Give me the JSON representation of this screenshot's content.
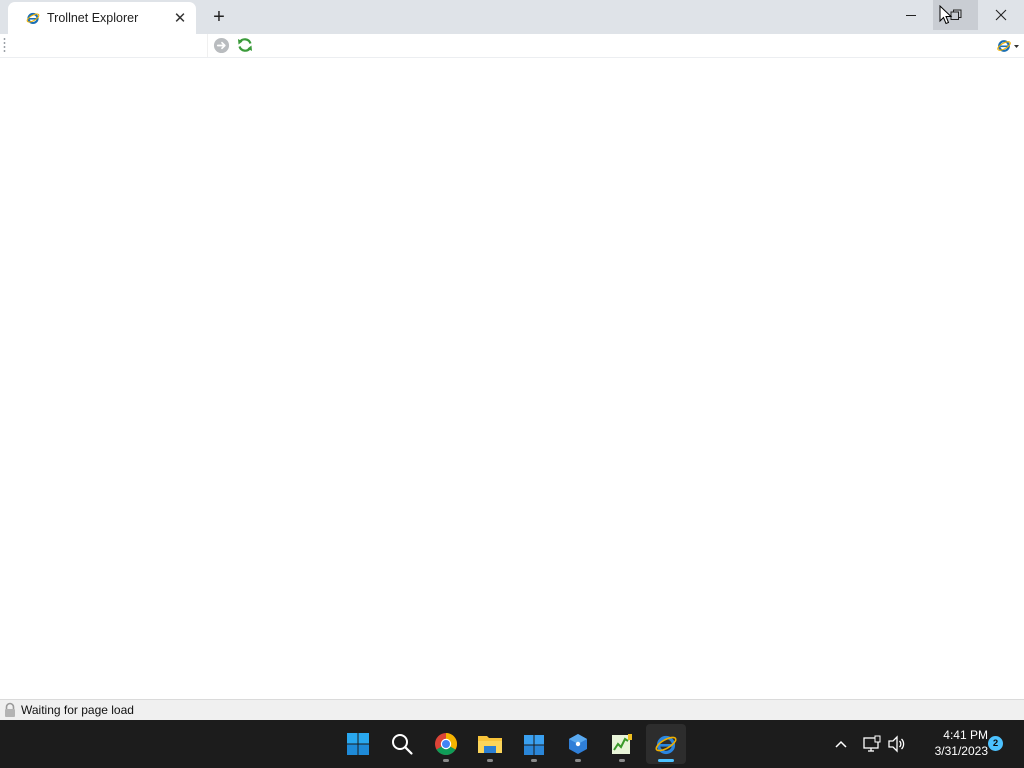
{
  "browser": {
    "tab": {
      "title": "Trollnet Explorer",
      "close_glyph": "✕",
      "icon": "ie-logo-icon"
    },
    "new_tab_glyph": "+",
    "window_controls": {
      "minimize": "minimize-icon",
      "maximize": "restore-icon",
      "close": "close-icon",
      "hovered": "restore"
    },
    "toolbar": {
      "go": "go-arrow-icon",
      "refresh": "refresh-icon",
      "page_menu": "ie-page-menu-icon"
    },
    "status": {
      "text": "Waiting for page load",
      "icon": "lock-icon"
    }
  },
  "taskbar": {
    "apps": [
      {
        "name": "start",
        "icon": "windows-logo-icon",
        "running": false,
        "active": false
      },
      {
        "name": "search",
        "icon": "search-icon",
        "running": false,
        "active": false
      },
      {
        "name": "chrome",
        "icon": "chrome-icon",
        "running": true,
        "active": false
      },
      {
        "name": "file-explorer",
        "icon": "folder-icon",
        "running": true,
        "active": false
      },
      {
        "name": "store",
        "icon": "store-icon",
        "running": true,
        "active": false
      },
      {
        "name": "network-app",
        "icon": "network-cube-icon",
        "running": true,
        "active": false
      },
      {
        "name": "task-manager",
        "icon": "chart-icon",
        "running": true,
        "active": false
      },
      {
        "name": "trollnet-explorer",
        "icon": "ie-logo-icon",
        "running": true,
        "active": true
      }
    ],
    "tray": {
      "chevron": "chevron-up-icon",
      "network": "network-icon",
      "volume": "speaker-icon",
      "time": "4:41 PM",
      "date": "3/31/2023",
      "notification_count": "2"
    }
  },
  "colors": {
    "titlebar": "#dfe3e8",
    "taskbar": "#1c1c1c",
    "accent": "#4cc2ff",
    "statusbar": "#f0f0f0"
  }
}
